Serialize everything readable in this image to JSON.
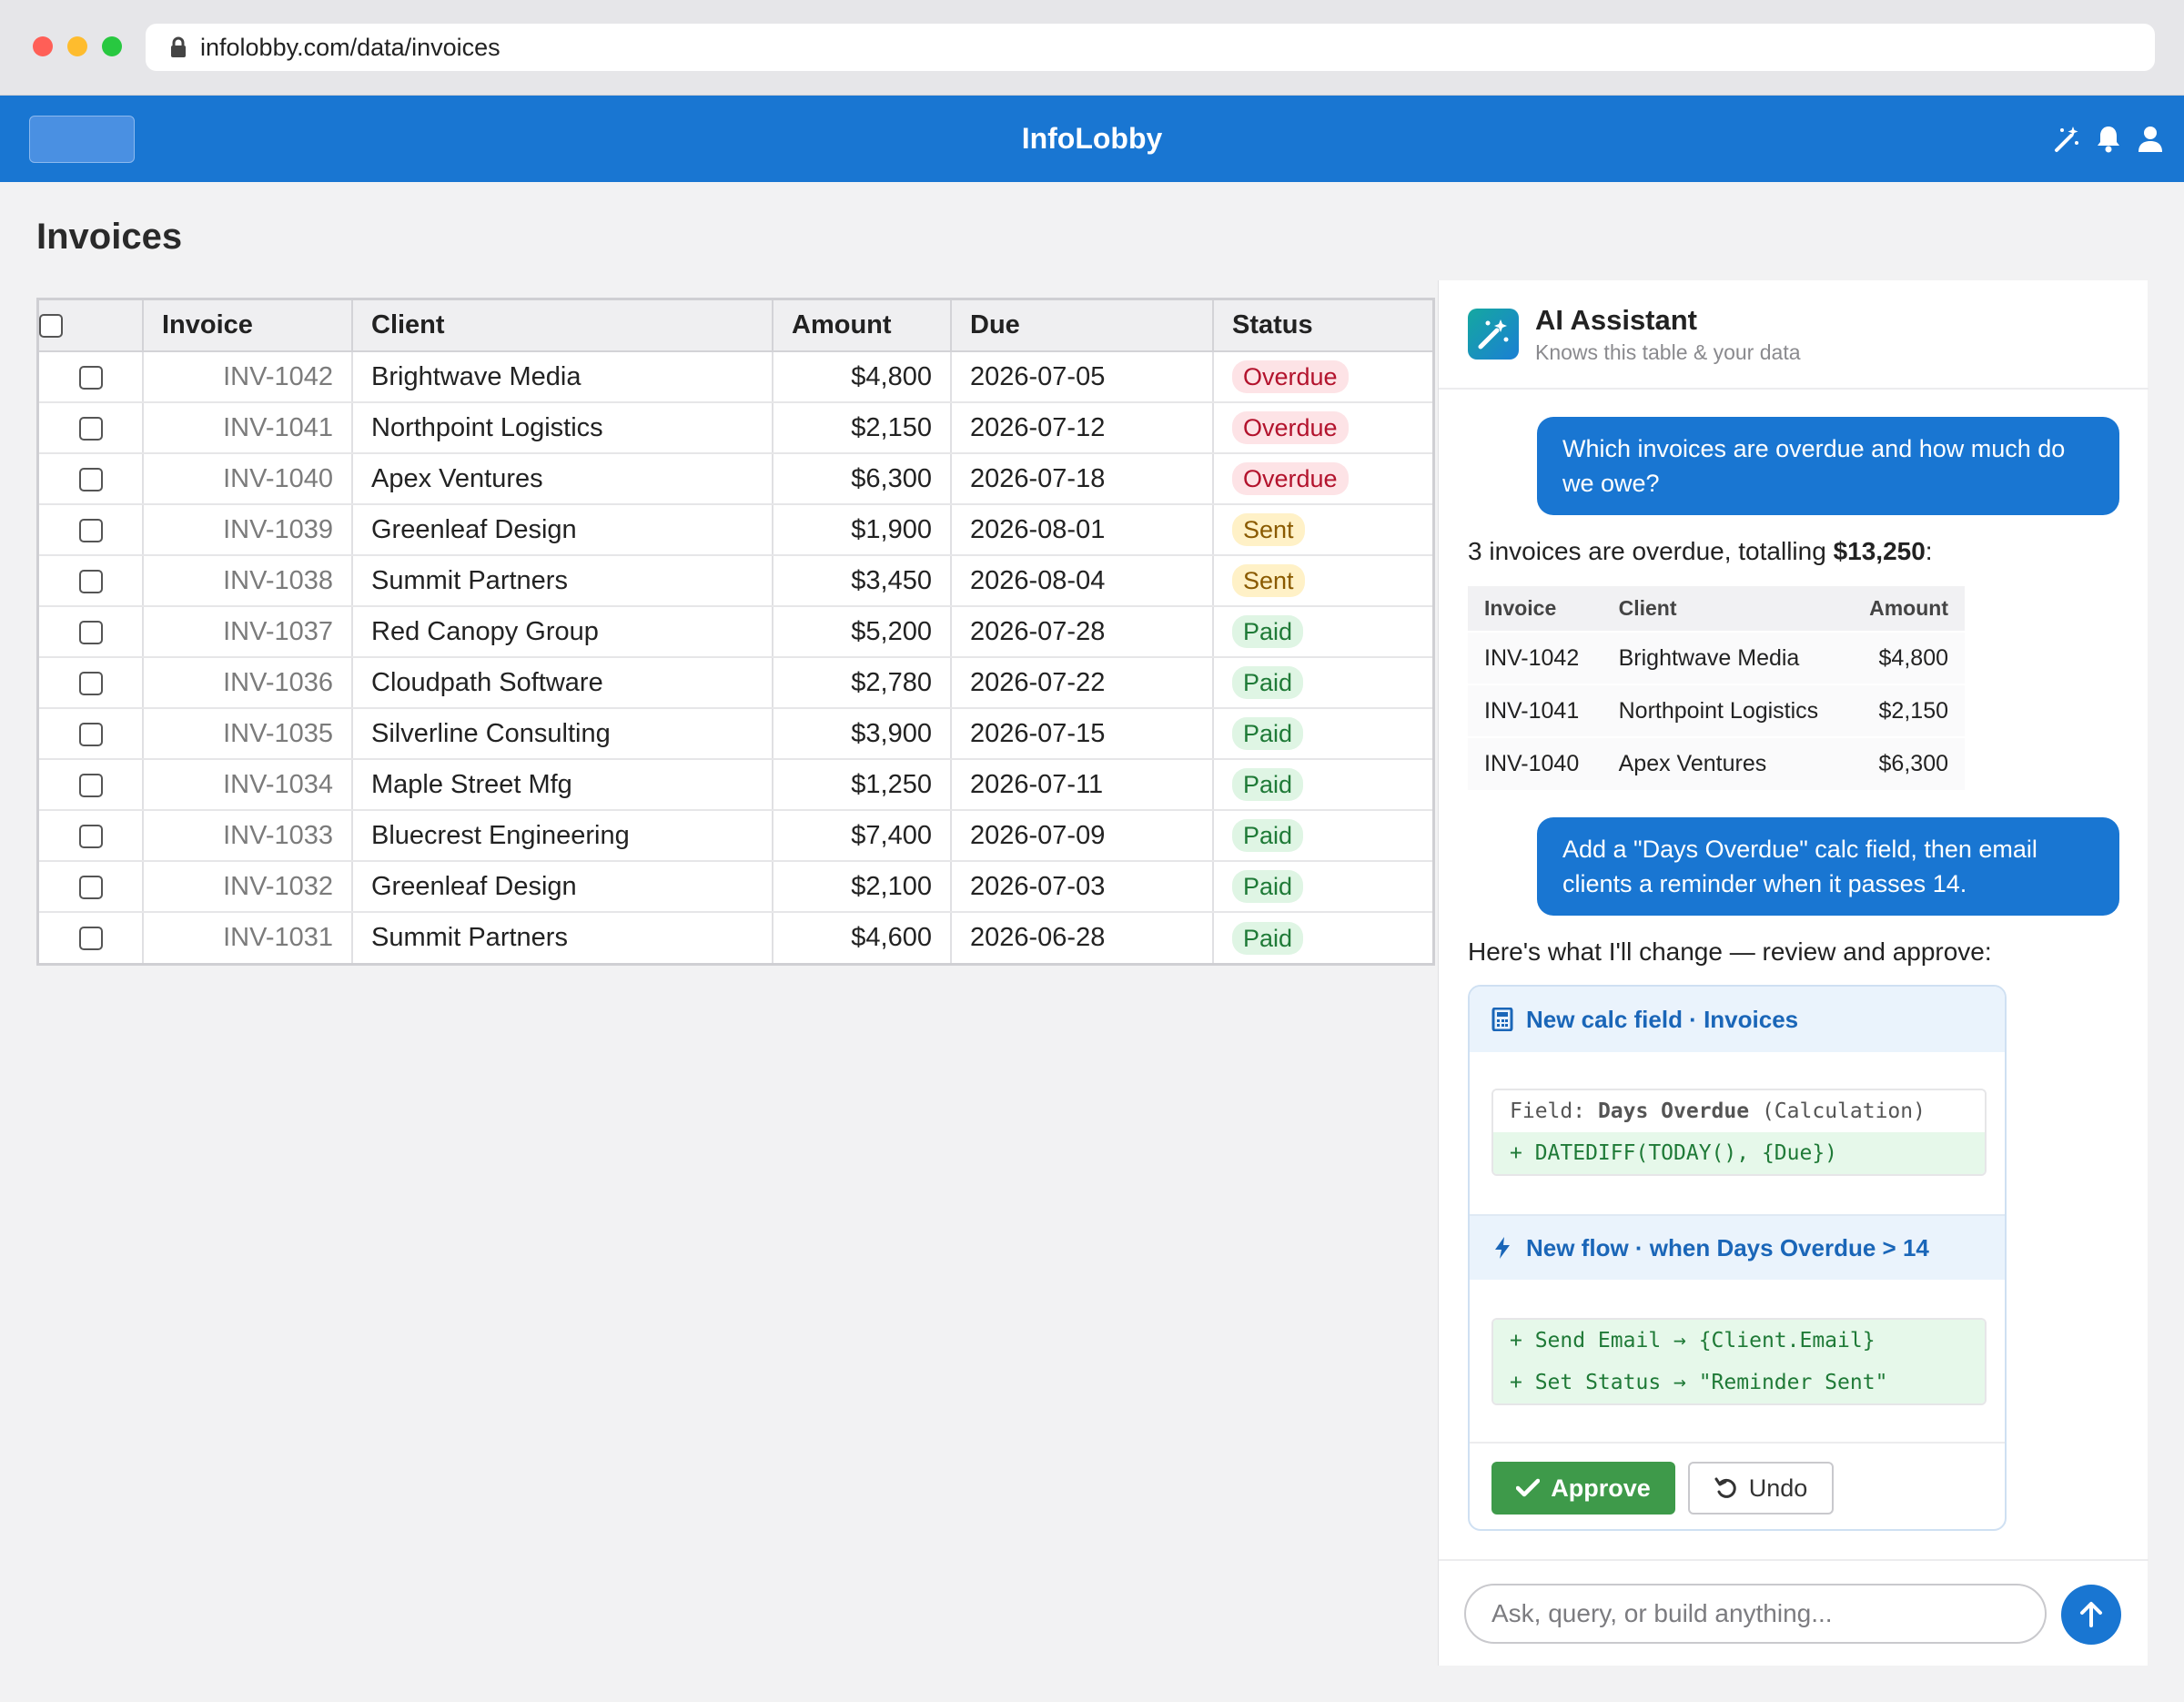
{
  "browser": {
    "url": "infolobby.com/data/invoices"
  },
  "app": {
    "title": "InfoLobby"
  },
  "page": {
    "title": "Invoices"
  },
  "table": {
    "headers": {
      "invoice": "Invoice",
      "client": "Client",
      "amount": "Amount",
      "due": "Due",
      "status": "Status"
    },
    "rows": [
      {
        "invoice": "INV-1042",
        "client": "Brightwave Media",
        "amount": "$4,800",
        "due": "2026-07-05",
        "status": "Overdue",
        "status_type": "overdue"
      },
      {
        "invoice": "INV-1041",
        "client": "Northpoint Logistics",
        "amount": "$2,150",
        "due": "2026-07-12",
        "status": "Overdue",
        "status_type": "overdue"
      },
      {
        "invoice": "INV-1040",
        "client": "Apex Ventures",
        "amount": "$6,300",
        "due": "2026-07-18",
        "status": "Overdue",
        "status_type": "overdue"
      },
      {
        "invoice": "INV-1039",
        "client": "Greenleaf Design",
        "amount": "$1,900",
        "due": "2026-08-01",
        "status": "Sent",
        "status_type": "sent"
      },
      {
        "invoice": "INV-1038",
        "client": "Summit Partners",
        "amount": "$3,450",
        "due": "2026-08-04",
        "status": "Sent",
        "status_type": "sent"
      },
      {
        "invoice": "INV-1037",
        "client": "Red Canopy Group",
        "amount": "$5,200",
        "due": "2026-07-28",
        "status": "Paid",
        "status_type": "paid"
      },
      {
        "invoice": "INV-1036",
        "client": "Cloudpath Software",
        "amount": "$2,780",
        "due": "2026-07-22",
        "status": "Paid",
        "status_type": "paid"
      },
      {
        "invoice": "INV-1035",
        "client": "Silverline Consulting",
        "amount": "$3,900",
        "due": "2026-07-15",
        "status": "Paid",
        "status_type": "paid"
      },
      {
        "invoice": "INV-1034",
        "client": "Maple Street Mfg",
        "amount": "$1,250",
        "due": "2026-07-11",
        "status": "Paid",
        "status_type": "paid"
      },
      {
        "invoice": "INV-1033",
        "client": "Bluecrest Engineering",
        "amount": "$7,400",
        "due": "2026-07-09",
        "status": "Paid",
        "status_type": "paid"
      },
      {
        "invoice": "INV-1032",
        "client": "Greenleaf Design",
        "amount": "$2,100",
        "due": "2026-07-03",
        "status": "Paid",
        "status_type": "paid"
      },
      {
        "invoice": "INV-1031",
        "client": "Summit Partners",
        "amount": "$4,600",
        "due": "2026-06-28",
        "status": "Paid",
        "status_type": "paid"
      }
    ]
  },
  "assistant": {
    "title": "AI Assistant",
    "subtitle": "Knows this table & your data",
    "msg1_user": "Which invoices are overdue and how much do we owe?",
    "msg1_reply_prefix": "3 invoices are overdue, totalling ",
    "msg1_reply_total": "$13,250",
    "msg1_reply_suffix": ":",
    "mini_table": {
      "headers": {
        "invoice": "Invoice",
        "client": "Client",
        "amount": "Amount"
      },
      "rows": [
        {
          "invoice": "INV-1042",
          "client": "Brightwave Media",
          "amount": "$4,800"
        },
        {
          "invoice": "INV-1041",
          "client": "Northpoint Logistics",
          "amount": "$2,150"
        },
        {
          "invoice": "INV-1040",
          "client": "Apex Ventures",
          "amount": "$6,300"
        }
      ]
    },
    "msg2_user": "Add a \"Days Overdue\" calc field, then email clients a reminder when it passes 14.",
    "msg2_reply": "Here's what I'll change — review and approve:",
    "change1": {
      "title": "New calc field · Invoices",
      "field_prefix": "Field: ",
      "field_name": "Days Overdue",
      "field_type": " (Calculation)",
      "formula": "+ DATEDIFF(TODAY(), {Due})"
    },
    "change2": {
      "title": "New flow · when Days Overdue > 14",
      "line1": "+ Send Email → {Client.Email}",
      "line2": "+ Set Status → \"Reminder Sent\""
    },
    "approve_label": "Approve",
    "undo_label": "Undo",
    "input_placeholder": "Ask, query, or build anything..."
  },
  "colors": {
    "brand": "#1976d2",
    "approve": "#3e9a4a",
    "overdue": "#b3132d",
    "sent": "#8a5a00",
    "paid": "#1f7a37"
  },
  "icons": [
    "lock-icon",
    "magic-wand-icon",
    "bell-icon",
    "user-icon",
    "calculator-icon",
    "lightning-icon",
    "check-icon",
    "undo-icon",
    "arrow-up-icon"
  ]
}
